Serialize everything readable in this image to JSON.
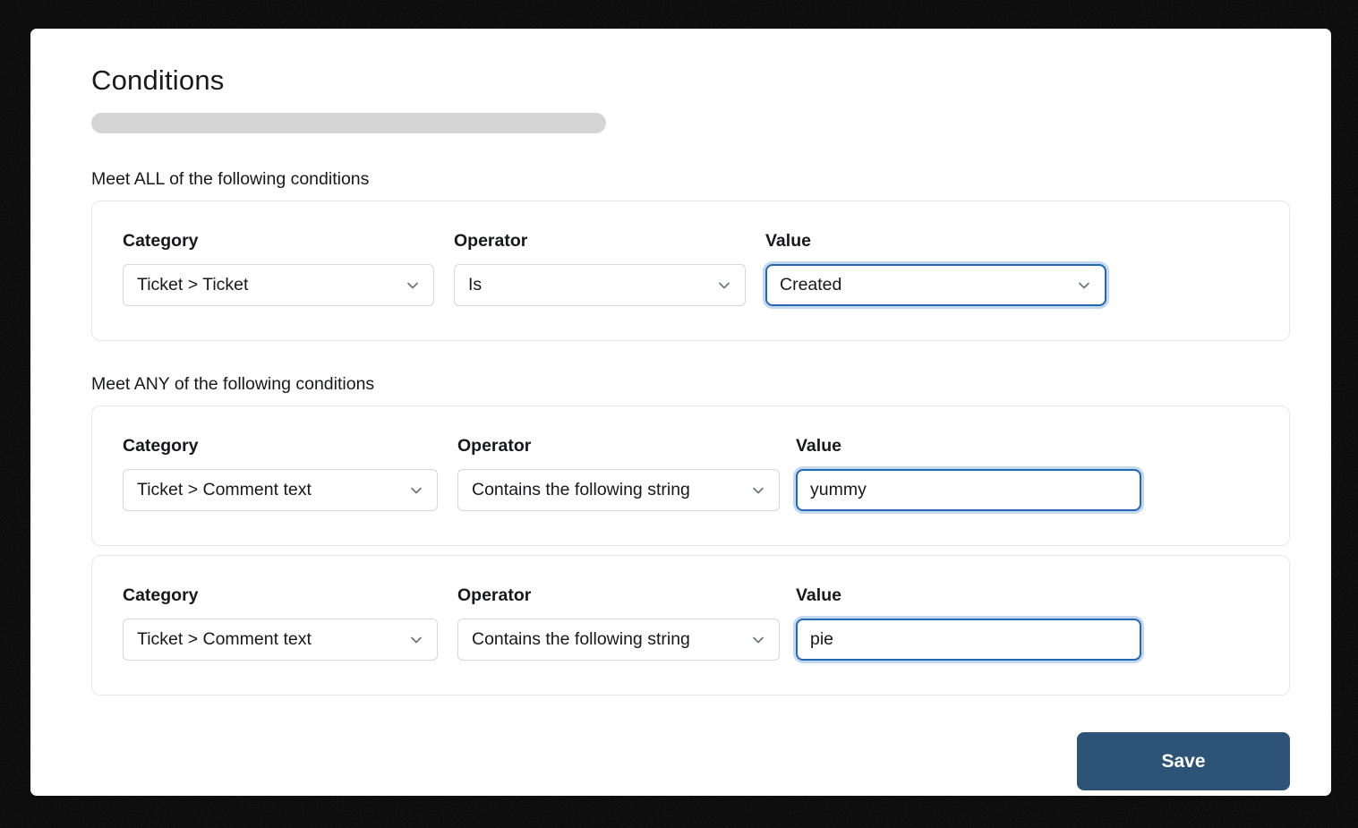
{
  "page": {
    "title": "Conditions"
  },
  "field_labels": {
    "category": "Category",
    "operator": "Operator",
    "value": "Value"
  },
  "sections": [
    {
      "heading": "Meet ALL of the following conditions",
      "rows": [
        {
          "category": "Ticket > Ticket",
          "operator": "Is",
          "value": "Created",
          "value_type": "select",
          "value_focused": true
        }
      ]
    },
    {
      "heading": "Meet ANY of the following conditions",
      "rows": [
        {
          "category": "Ticket > Comment text",
          "operator": "Contains the following string",
          "value": "yummy",
          "value_type": "text",
          "value_focused": true
        },
        {
          "category": "Ticket > Comment text",
          "operator": "Contains the following string",
          "value": "pie",
          "value_type": "text",
          "value_focused": true
        }
      ]
    }
  ],
  "save_button": {
    "label": "Save"
  },
  "colors": {
    "focus_border": "#2368b3",
    "focus_ring": "#c3d8ee",
    "save_background": "#2d5377",
    "control_border": "#d4d7db",
    "card_border": "#e6e7ea",
    "skeleton": "#d5d5d5",
    "text": "#17181a"
  },
  "icons": {
    "chevron_down": "chevron-down-icon"
  }
}
